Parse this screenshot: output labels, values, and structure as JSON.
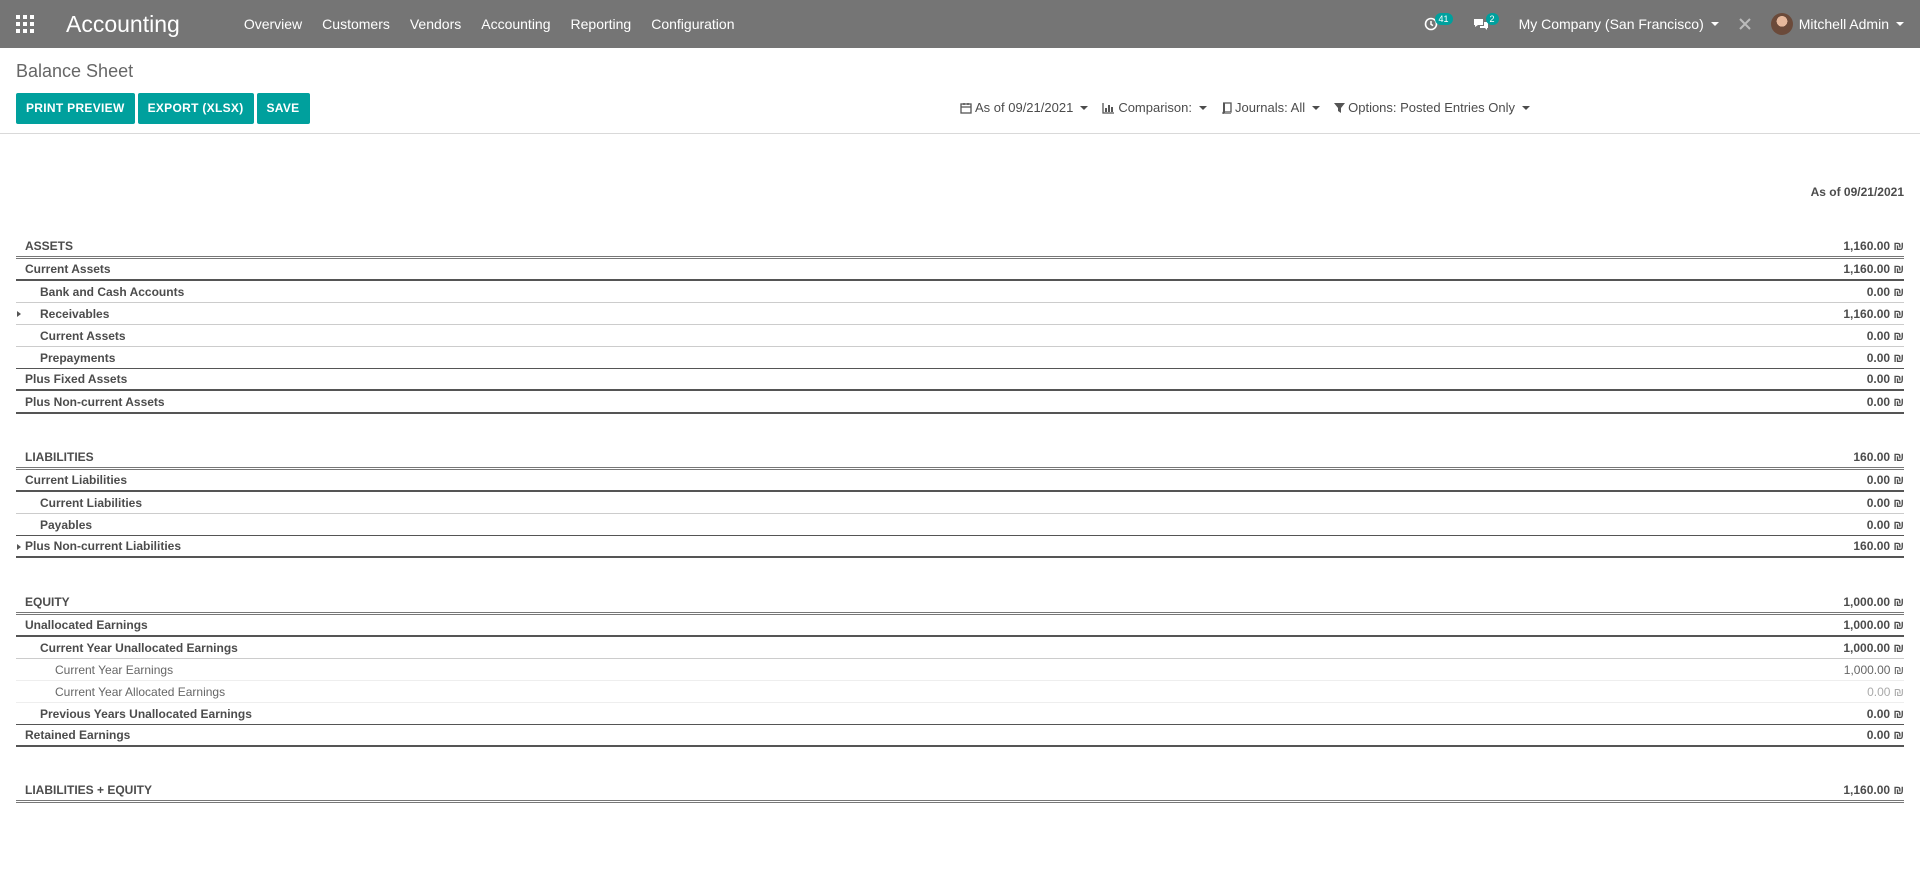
{
  "navbar": {
    "app_name": "Accounting",
    "menu": [
      "Overview",
      "Customers",
      "Vendors",
      "Accounting",
      "Reporting",
      "Configuration"
    ],
    "activity_count": "41",
    "messages_count": "2",
    "company": "My Company (San Francisco)",
    "user": "Mitchell Admin"
  },
  "page": {
    "title": "Balance Sheet",
    "buttons": [
      "PRINT PREVIEW",
      "EXPORT (XLSX)",
      "SAVE"
    ],
    "filters": {
      "date": "As of 09/21/2021",
      "comparison": "Comparison:",
      "journals": "Journals: All",
      "options": "Options: Posted Entries Only"
    }
  },
  "report": {
    "column_header": "As of 09/21/2021",
    "rows": [
      {
        "label": "ASSETS",
        "amount": "1,160.00 ₪"
      },
      {
        "label": "Current Assets",
        "amount": "1,160.00 ₪"
      },
      {
        "label": "Bank and Cash Accounts",
        "amount": "0.00 ₪"
      },
      {
        "label": "Receivables",
        "amount": "1,160.00 ₪"
      },
      {
        "label": "Current Assets",
        "amount": "0.00 ₪"
      },
      {
        "label": "Prepayments",
        "amount": "0.00 ₪"
      },
      {
        "label": "Plus Fixed Assets",
        "amount": "0.00 ₪"
      },
      {
        "label": "Plus Non-current Assets",
        "amount": "0.00 ₪"
      },
      {
        "label": "LIABILITIES",
        "amount": "160.00 ₪"
      },
      {
        "label": "Current Liabilities",
        "amount": "0.00 ₪"
      },
      {
        "label": "Current Liabilities",
        "amount": "0.00 ₪"
      },
      {
        "label": "Payables",
        "amount": "0.00 ₪"
      },
      {
        "label": "Plus Non-current Liabilities",
        "amount": "160.00 ₪"
      },
      {
        "label": "EQUITY",
        "amount": "1,000.00 ₪"
      },
      {
        "label": "Unallocated Earnings",
        "amount": "1,000.00 ₪"
      },
      {
        "label": "Current Year Unallocated Earnings",
        "amount": "1,000.00 ₪"
      },
      {
        "label": "Current Year Earnings",
        "amount": "1,000.00 ₪"
      },
      {
        "label": "Current Year Allocated Earnings",
        "amount": "0.00 ₪"
      },
      {
        "label": "Previous Years Unallocated Earnings",
        "amount": "0.00 ₪"
      },
      {
        "label": "Retained Earnings",
        "amount": "0.00 ₪"
      },
      {
        "label": "LIABILITIES + EQUITY",
        "amount": "1,160.00 ₪"
      }
    ]
  }
}
